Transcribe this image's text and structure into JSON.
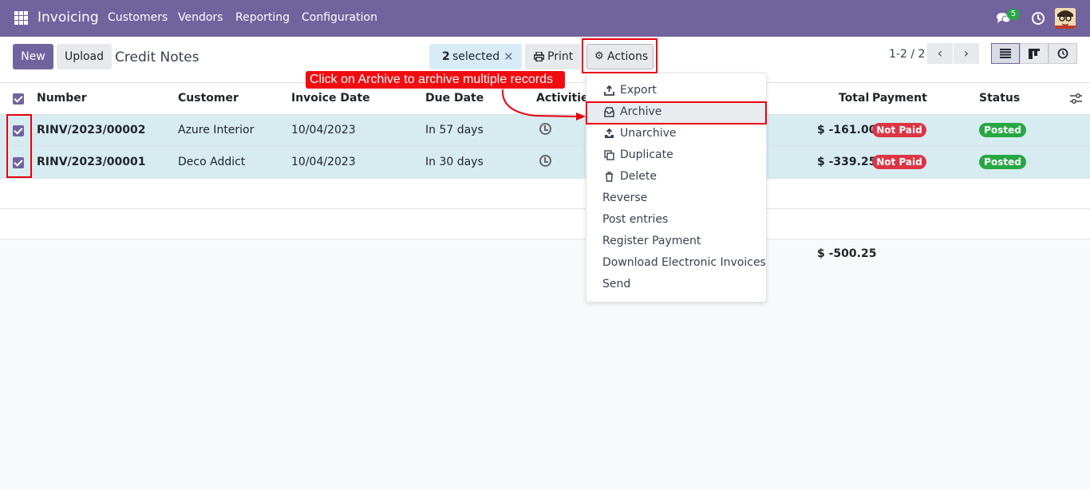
{
  "navbar": {
    "brand": "Invoicing",
    "menu": [
      "Customers",
      "Vendors",
      "Reporting",
      "Configuration"
    ],
    "message_count": "5"
  },
  "control_panel": {
    "new_label": "New",
    "upload_label": "Upload",
    "title": "Credit Notes",
    "selected_count": "2",
    "selected_label": "selected",
    "print_label": "Print",
    "actions_label": "Actions",
    "pager": "1-2 / 2"
  },
  "table": {
    "headers": {
      "number": "Number",
      "customer": "Customer",
      "invoice_date": "Invoice Date",
      "due_date": "Due Date",
      "activities": "Activities",
      "total": "Total",
      "payment": "Payment",
      "status": "Status"
    },
    "rows": [
      {
        "number": "RINV/2023/00002",
        "customer": "Azure Interior",
        "invoice_date": "10/04/2023",
        "due_date": "In 57 days",
        "total": "$ -161.00",
        "payment": "Not Paid",
        "status": "Posted"
      },
      {
        "number": "RINV/2023/00001",
        "customer": "Deco Addict",
        "invoice_date": "10/04/2023",
        "due_date": "In 30 days",
        "total": "$ -339.25",
        "payment": "Not Paid",
        "status": "Posted"
      }
    ],
    "grand_total": "$ -500.25"
  },
  "actions_menu": {
    "items": [
      "Export",
      "Archive",
      "Unarchive",
      "Duplicate",
      "Delete",
      "Reverse",
      "Post entries",
      "Register Payment",
      "Download Electronic Invoices",
      "Send"
    ]
  },
  "annotation": {
    "callout_text": "Click on Archive to archive multiple records"
  },
  "colors": {
    "primary": "#71639e",
    "highlight": "#e8000c",
    "not_paid": "#dc3545",
    "posted": "#28a745"
  }
}
